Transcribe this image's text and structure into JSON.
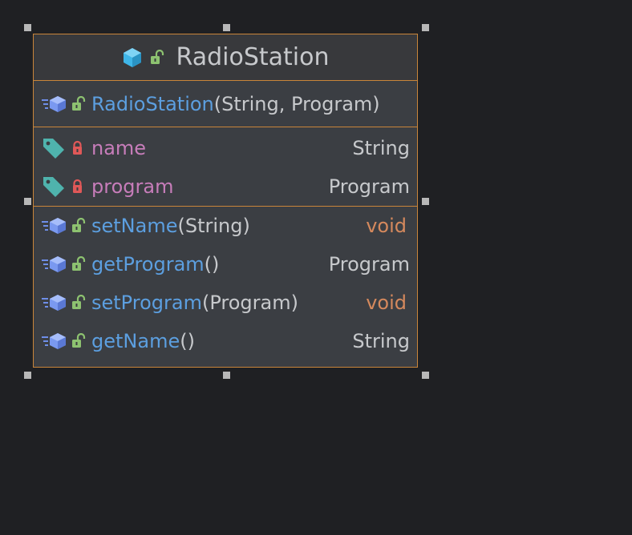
{
  "class_box": {
    "title": "RadioStation",
    "constructor": {
      "name": "RadioStation",
      "params": "(String, Program)"
    },
    "fields": [
      {
        "name": "name",
        "type": "String"
      },
      {
        "name": "program",
        "type": "Program"
      }
    ],
    "methods": [
      {
        "name": "setName",
        "params": "(String)",
        "type": "void"
      },
      {
        "name": "getProgram",
        "params": "()",
        "type": "Program"
      },
      {
        "name": "setProgram",
        "params": "(Program)",
        "type": "void"
      },
      {
        "name": "getName",
        "params": "()",
        "type": "String"
      }
    ]
  },
  "colors": {
    "border": "#c9853a",
    "method_name": "#5c9fe0",
    "field_name": "#c77dba",
    "void_type": "#d5895d",
    "public_lock": "#8dc270",
    "private_lock": "#e05858",
    "class_icon": "#3fb6e8",
    "field_tag": "#4fb3ad"
  },
  "icons": {
    "class": "class-cube-icon",
    "public": "unlocked-padlock-icon",
    "private": "locked-padlock-icon",
    "method": "method-cube-icon",
    "field": "field-tag-icon"
  }
}
